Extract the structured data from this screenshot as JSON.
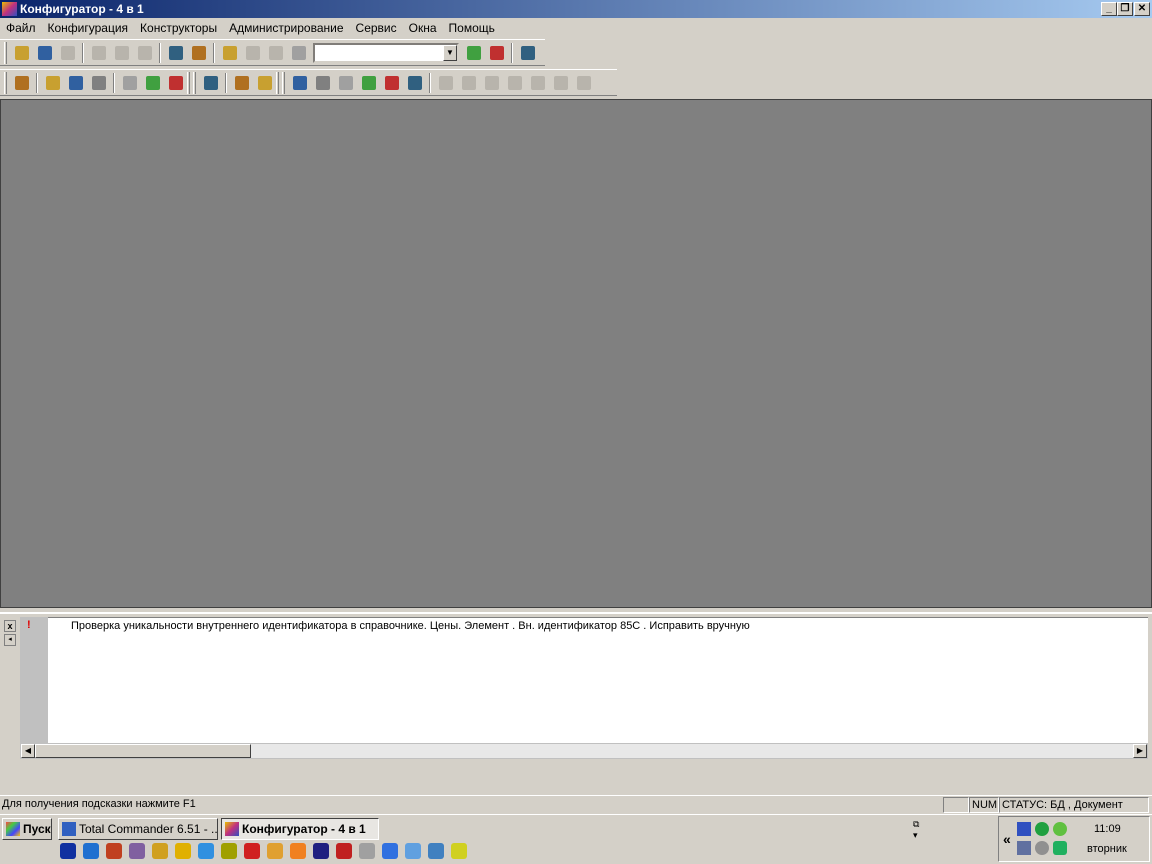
{
  "window": {
    "title": "Конфигуратор - 4 в 1"
  },
  "menu": [
    "Файл",
    "Конфигурация",
    "Конструкторы",
    "Администрирование",
    "Сервис",
    "Окна",
    "Помощь"
  ],
  "toolbar1": {
    "groups": [
      [
        "new-icon",
        "open-icon",
        "save-icon"
      ],
      [
        "cut-icon",
        "copy-icon",
        "paste-icon"
      ],
      [
        "print-icon",
        "print-preview-icon"
      ],
      [
        "syntax-helper-icon",
        "undo-icon",
        "redo-icon",
        "find-icon"
      ]
    ],
    "search_value": "",
    "after": [
      [
        "find-next-icon",
        "find-prev-icon"
      ],
      [
        "help-icon"
      ]
    ]
  },
  "toolbar2": {
    "groups": [
      [
        "config-tree-icon"
      ],
      [
        "metadata-icon",
        "users-icon",
        "search-users-icon"
      ],
      [
        "wizard-icon",
        "stop-icon",
        "check-icon"
      ],
      [
        "user-icon"
      ],
      [
        "import-icon",
        "export-icon"
      ],
      [
        "designer-1-icon",
        "designer-2-icon",
        "designer-3-icon",
        "designer-4-icon",
        "designer-5-icon",
        "designer-6-icon"
      ],
      [
        "designer-7-icon",
        "designer-8-icon",
        "designer-9-icon",
        "designer-10-icon",
        "designer-11-icon",
        "designer-12-icon",
        "designer-13-icon"
      ]
    ]
  },
  "messages": [
    {
      "marker": "!",
      "text": "Проверка уникальности внутреннего идентификатора в справочнике. Цены. Элемент . Вн. идентификатор    85C   . Исправить вручную"
    }
  ],
  "status": {
    "hint": "Для получения подсказки нажмите F1",
    "num": "NUM",
    "state": "СТАТУС: БД , Документ"
  },
  "taskbar": {
    "start": "Пуск",
    "buttons": [
      "Total Commander 6.51 - ...",
      "Конфигуратор - 4 в 1"
    ],
    "clock": "11:09",
    "day": "вторник",
    "chevron": "«"
  },
  "colors": {
    "title_start": "#0a246a",
    "title_end": "#a6caf0",
    "mdi": "#808080"
  }
}
